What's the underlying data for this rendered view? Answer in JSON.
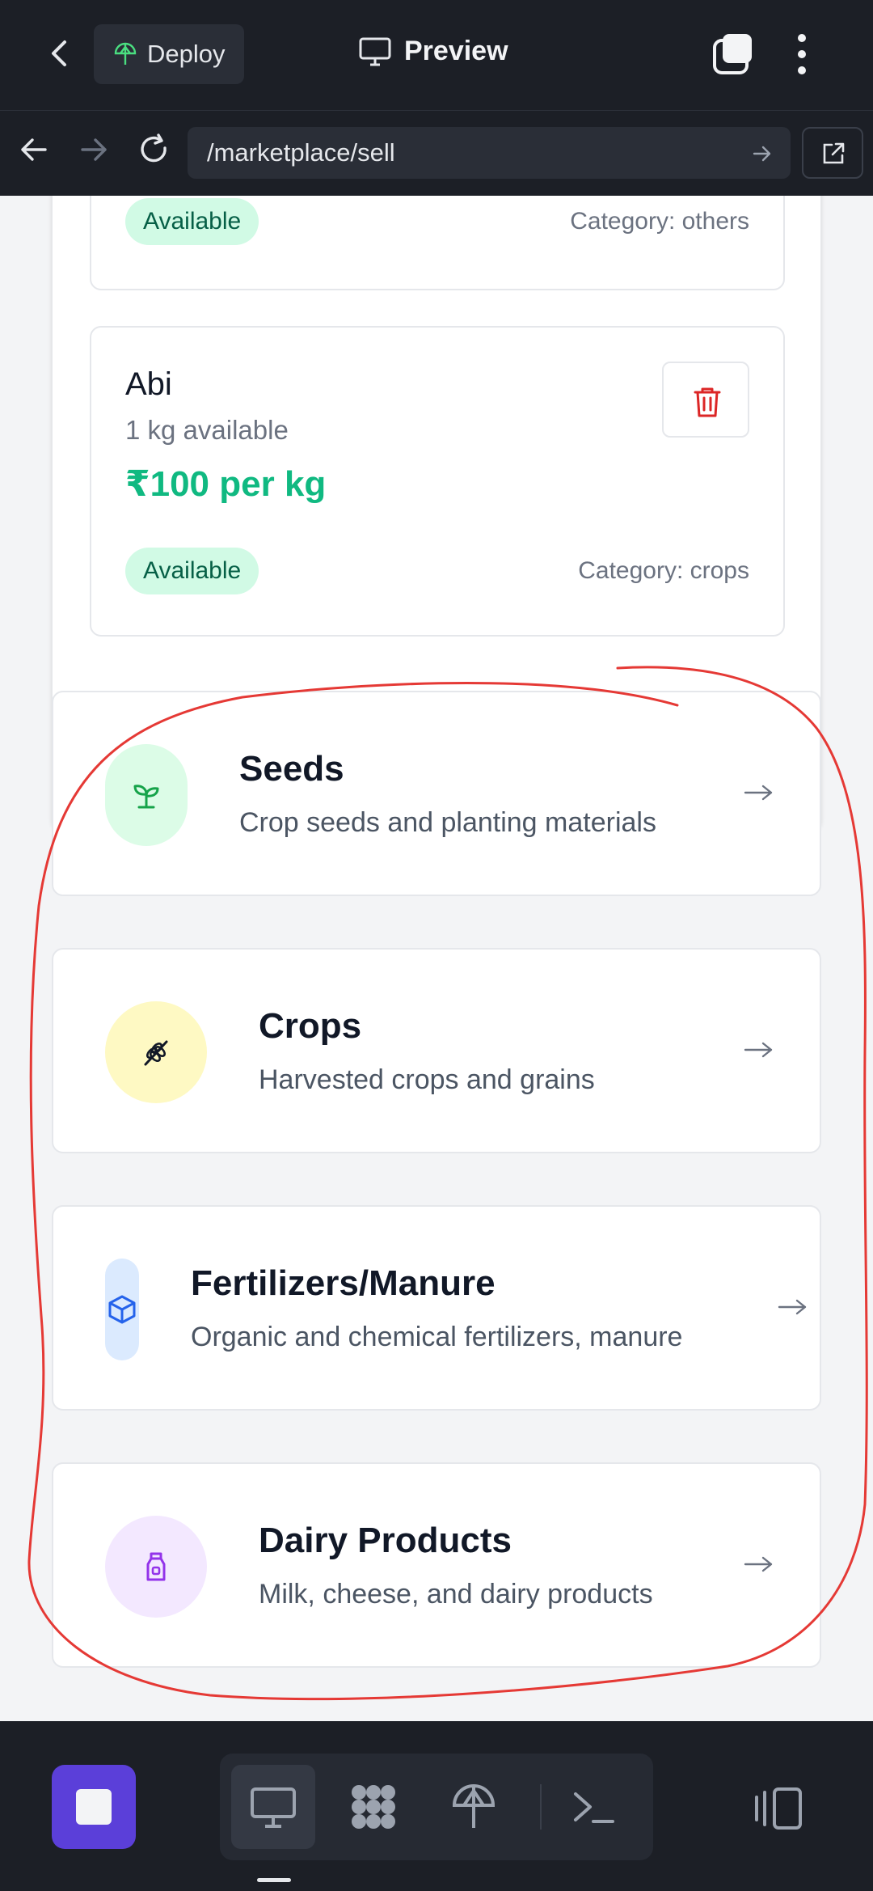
{
  "topbar": {
    "deploy_label": "Deploy",
    "preview_label": "Preview"
  },
  "urlbar": {
    "url": "/marketplace/sell"
  },
  "listings": [
    {
      "status": "Available",
      "category": "Category: others"
    },
    {
      "name": "Abi",
      "quantity": "1 kg available",
      "price": "₹100 per kg",
      "status": "Available",
      "category": "Category: crops"
    }
  ],
  "categories": [
    {
      "title": "Seeds",
      "description": "Crop seeds and planting materials",
      "icon": "sprout-icon",
      "icon_bg": "#dcfce7",
      "icon_color": "#16a34a"
    },
    {
      "title": "Crops",
      "description": "Harvested crops and grains",
      "icon": "wheat-icon",
      "icon_bg": "#fef9c3",
      "icon_color": "#111827"
    },
    {
      "title": "Fertilizers/Manure",
      "description": "Organic and chemical fertilizers, manure",
      "icon": "package-icon",
      "icon_bg": "#dbeafe",
      "icon_color": "#2563eb"
    },
    {
      "title": "Dairy Products",
      "description": "Milk, cheese, and dairy products",
      "icon": "milk-icon",
      "icon_bg": "#f3e8ff",
      "icon_color": "#9333ea"
    }
  ],
  "colors": {
    "price": "#10b981",
    "annotation": "#e53935",
    "stop_button": "#5b3fd9"
  }
}
